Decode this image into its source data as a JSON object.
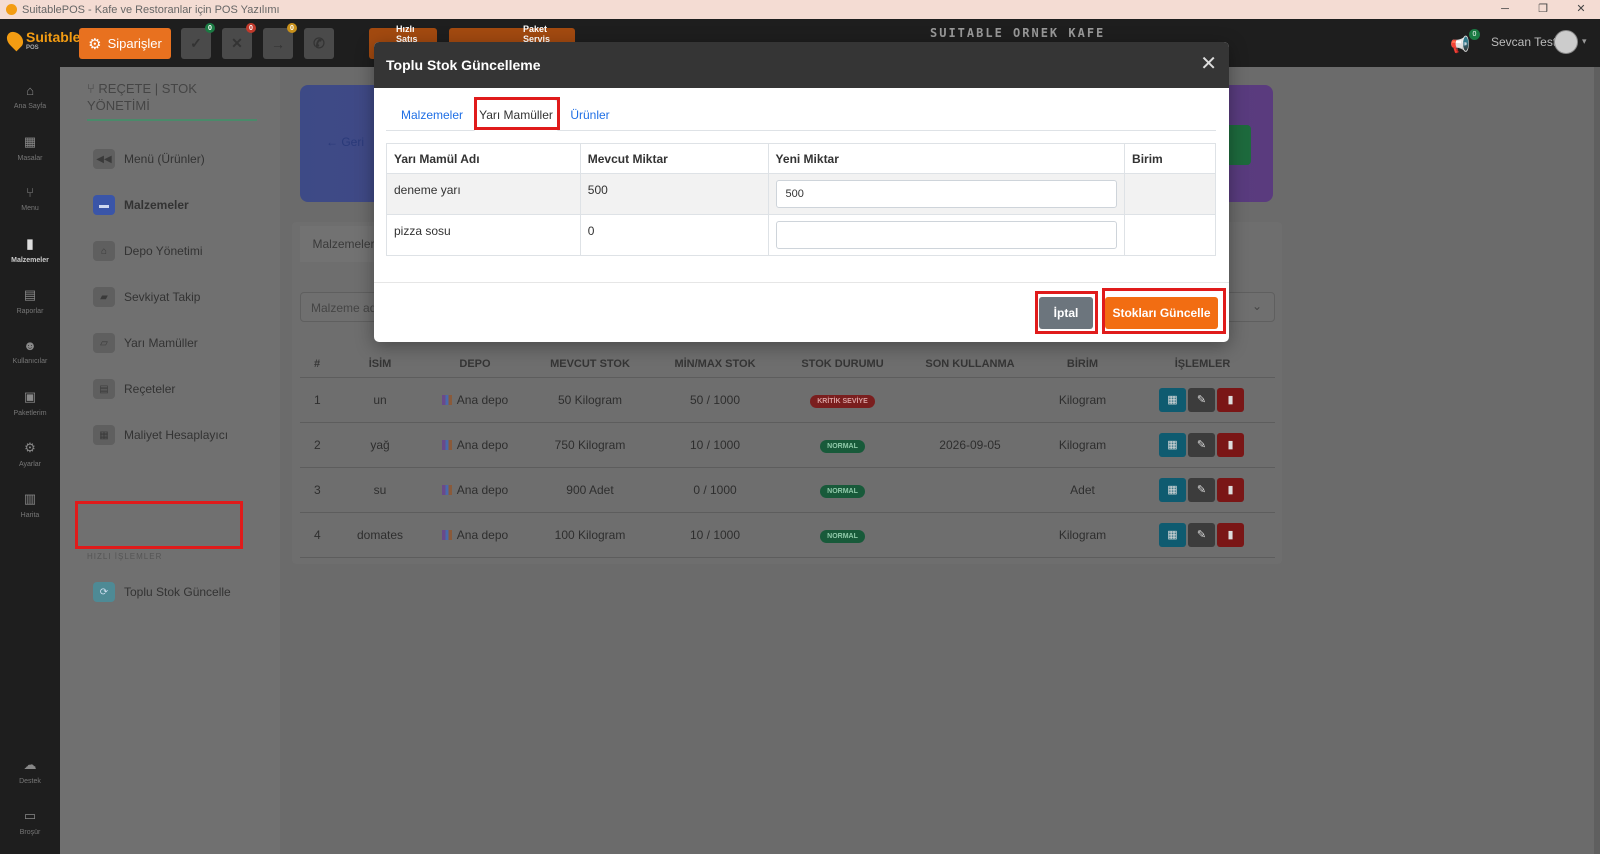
{
  "window": {
    "title": "SuitablePOS - Kafe ve Restoranlar için POS Yazılımı",
    "controls": [
      "─",
      "❐",
      "✕"
    ]
  },
  "topnav": {
    "logo_text": "Suitable",
    "logo_sub": "POS",
    "orders_label": "Siparişler",
    "quick_buttons": [
      {
        "icon": "check-icon",
        "glyph": "✓",
        "color": "#2a9d4b",
        "badge": "0",
        "badge_color": "#1b7a43"
      },
      {
        "icon": "cross-icon",
        "glyph": "✕",
        "color": "#d93030",
        "badge": "0",
        "badge_color": "#c0392b"
      },
      {
        "icon": "arrow-right-icon",
        "glyph": "→",
        "color": "#e0a020",
        "badge": "0",
        "badge_color": "#c8901a"
      },
      {
        "icon": "phone-icon",
        "glyph": "✆",
        "color": "#2a9d4b",
        "badge": "",
        "badge_color": ""
      }
    ],
    "tab1_label": "Hızlı Satış",
    "tab2_label": "Paket Servis",
    "brand": "SUITABLE ORNEK KAFE",
    "notification_badge": "0",
    "user_name": "Sevcan Test"
  },
  "rail": [
    {
      "label": "Ana Sayfa",
      "icon": "home-icon",
      "glyph": "⌂"
    },
    {
      "label": "Masalar",
      "icon": "table-icon",
      "glyph": "▦"
    },
    {
      "label": "Menu",
      "icon": "utensils-icon",
      "glyph": "⑂"
    },
    {
      "label": "Malzemeler",
      "icon": "clipboard-icon",
      "glyph": "▮",
      "active": true
    },
    {
      "label": "Raporlar",
      "icon": "report-icon",
      "glyph": "▤"
    },
    {
      "label": "Kullanıcılar",
      "icon": "users-icon",
      "glyph": "☻"
    },
    {
      "label": "Paketlerim",
      "icon": "gift-icon",
      "glyph": "▣"
    },
    {
      "label": "Ayarlar",
      "icon": "gears-icon",
      "glyph": "⚙"
    },
    {
      "label": "Harita",
      "icon": "map-icon",
      "glyph": "▥"
    },
    {
      "label": "Destek",
      "icon": "chat-icon",
      "glyph": "☁"
    },
    {
      "label": "Broşür",
      "icon": "brochure-icon",
      "glyph": "▭"
    }
  ],
  "sidebar": {
    "title": "REÇETE | STOK YÖNETİMİ",
    "items": [
      {
        "label": "Menü (Ürünler)",
        "icon": "backward-icon",
        "glyph": "◀◀"
      },
      {
        "label": "Malzemeler",
        "icon": "calendar-icon",
        "glyph": "▬",
        "bold": true
      },
      {
        "label": "Depo Yönetimi",
        "icon": "warehouse-icon",
        "glyph": "⌂"
      },
      {
        "label": "Sevkiyat Takip",
        "icon": "truck-icon",
        "glyph": "▰"
      },
      {
        "label": "Yarı Mamüller",
        "icon": "box-icon",
        "glyph": "▱"
      },
      {
        "label": "Reçeteler",
        "icon": "recipe-icon",
        "glyph": "▤"
      },
      {
        "label": "Maliyet Hesaplayıcı",
        "icon": "calculator-icon",
        "glyph": "▦"
      }
    ],
    "section_label": "HIZLI İŞLEMLER",
    "quick_item": {
      "label": "Toplu Stok Güncelle",
      "icon": "sync-icon",
      "glyph": "⟳"
    }
  },
  "main": {
    "back_label": "← Geri",
    "tab_label": "Malzemeler",
    "search_placeholder": "Malzeme adı",
    "headers": [
      "#",
      "İSİM",
      "DEPO",
      "MEVCUT STOK",
      "MİN/MAX STOK",
      "STOK DURUMU",
      "SON KULLANMA",
      "BİRİM",
      "İŞLEMLER"
    ],
    "rows": [
      {
        "no": "1",
        "name": "un",
        "depot": "Ana depo",
        "stock": "50 Kilogram",
        "minmax": "50 / 1000",
        "status": "KRİTİK SEVİYE",
        "status_type": "crit",
        "expiry": "",
        "unit": "Kilogram"
      },
      {
        "no": "2",
        "name": "yağ",
        "depot": "Ana depo",
        "stock": "750 Kilogram",
        "minmax": "10 / 1000",
        "status": "NORMAL",
        "status_type": "norm",
        "expiry": "2026-09-05",
        "unit": "Kilogram"
      },
      {
        "no": "3",
        "name": "su",
        "depot": "Ana depo",
        "stock": "900 Adet",
        "minmax": "0 / 1000",
        "status": "NORMAL",
        "status_type": "norm",
        "expiry": "",
        "unit": "Adet"
      },
      {
        "no": "4",
        "name": "domates",
        "depot": "Ana depo",
        "stock": "100 Kilogram",
        "minmax": "10 / 1000",
        "status": "NORMAL",
        "status_type": "norm",
        "expiry": "",
        "unit": "Kilogram"
      }
    ]
  },
  "modal": {
    "title": "Toplu Stok Güncelleme",
    "close_glyph": "✕",
    "tabs": [
      "Malzemeler",
      "Yarı Mamüller",
      "Ürünler"
    ],
    "active_tab": 1,
    "headers": [
      "Yarı Mamül Adı",
      "Mevcut Miktar",
      "Yeni Miktar",
      "Birim"
    ],
    "rows": [
      {
        "name": "deneme yarı",
        "current": "500",
        "new_value": "500",
        "unit": ""
      },
      {
        "name": "pizza sosu",
        "current": "0",
        "new_value": "",
        "unit": ""
      }
    ],
    "cancel_label": "İptal",
    "update_label": "Stokları Güncelle"
  }
}
